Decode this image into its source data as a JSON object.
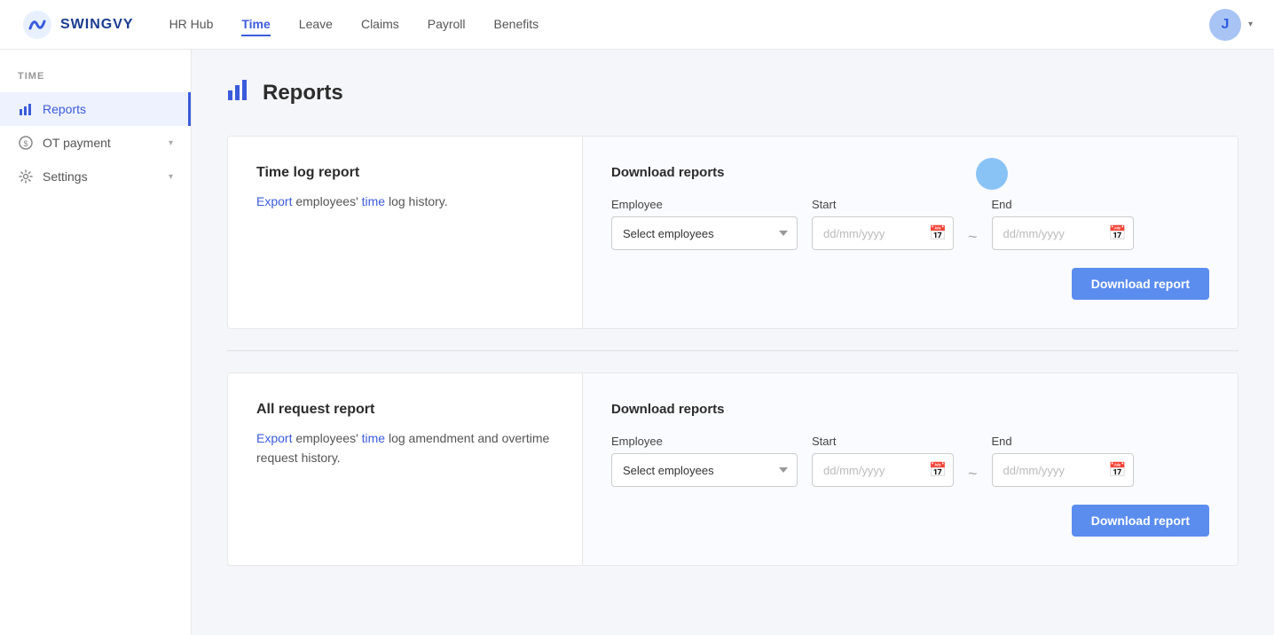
{
  "app": {
    "logo_text": "SWINGVY"
  },
  "top_nav": {
    "links": [
      {
        "label": "HR Hub",
        "active": false
      },
      {
        "label": "Time",
        "active": true
      },
      {
        "label": "Leave",
        "active": false
      },
      {
        "label": "Claims",
        "active": false
      },
      {
        "label": "Payroll",
        "active": false
      },
      {
        "label": "Benefits",
        "active": false
      }
    ],
    "avatar_letter": "J"
  },
  "sidebar": {
    "section_label": "TIME",
    "items": [
      {
        "label": "Reports",
        "active": true,
        "icon": "bar-chart-icon"
      },
      {
        "label": "OT payment",
        "active": false,
        "icon": "dollar-circle-icon",
        "has_chevron": true
      },
      {
        "label": "Settings",
        "active": false,
        "icon": "gear-icon",
        "has_chevron": true
      }
    ]
  },
  "page": {
    "title": "Reports",
    "icon": "reports-icon"
  },
  "report_sections": [
    {
      "id": "time-log",
      "title": "Time log report",
      "description_parts": [
        {
          "text": "Export",
          "highlight": true
        },
        {
          "text": " employees' "
        },
        {
          "text": "time",
          "highlight": true
        },
        {
          "text": " log history."
        }
      ],
      "download_reports_label": "Download reports",
      "employee_label": "Employee",
      "employee_placeholder": "Select employees",
      "start_label": "Start",
      "start_placeholder": "dd/mm/yyyy",
      "end_label": "End",
      "end_placeholder": "dd/mm/yyyy",
      "btn_label": "Download report"
    },
    {
      "id": "all-request",
      "title": "All request report",
      "description_parts": [
        {
          "text": "Export",
          "highlight": true
        },
        {
          "text": " employees' "
        },
        {
          "text": "time",
          "highlight": true
        },
        {
          "text": " log amendment and overtime request history."
        }
      ],
      "download_reports_label": "Download reports",
      "employee_label": "Employee",
      "employee_placeholder": "Select employees",
      "start_label": "Start",
      "start_placeholder": "dd/mm/yyyy",
      "end_label": "End",
      "end_placeholder": "dd/mm/yyyy",
      "btn_label": "Download report"
    }
  ],
  "colors": {
    "primary": "#5b8def",
    "link": "#3b5bdb",
    "spinner": "#74b9f5"
  }
}
